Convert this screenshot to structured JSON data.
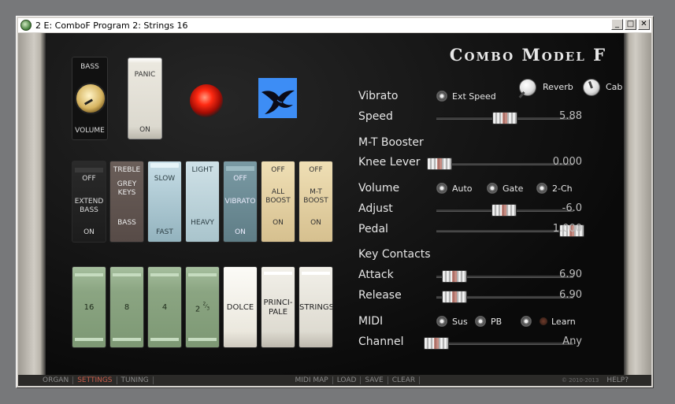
{
  "window": {
    "title": "2 E: ComboF Program 2: Strings 16",
    "buttons": [
      "_",
      "□",
      "✕"
    ]
  },
  "logo": "Combo Model F",
  "volume_box": {
    "top": "BASS",
    "bottom": "VOLUME"
  },
  "panic": {
    "top": "PANIC",
    "bottom": "ON"
  },
  "switches": [
    {
      "t": "OFF",
      "m": "EXTEND\nBASS",
      "b": "ON"
    },
    {
      "t": "TREBLE",
      "m": "GREY\nKEYS",
      "b": "BASS"
    },
    {
      "t": "SLOW",
      "m": "",
      "b": "FAST"
    },
    {
      "t": "LIGHT",
      "m": "",
      "b": "HEAVY"
    },
    {
      "t": "OFF",
      "m": "VIBRATO",
      "b": "ON"
    },
    {
      "t": "OFF",
      "m": "ALL\nBOOST",
      "b": "ON"
    },
    {
      "t": "OFF",
      "m": "M-T\nBOOST",
      "b": "ON"
    }
  ],
  "footages": [
    "16",
    "8",
    "4",
    "2",
    "DOLCE",
    "PRINCI-\nPALE",
    "STRINGS"
  ],
  "footage_fraction": {
    "num": "2",
    "den": "3"
  },
  "controls": {
    "vibrato_label": "Vibrato",
    "ext_speed": "Ext Speed",
    "reverb": "Reverb",
    "cab": "Cab",
    "speed_label": "Speed",
    "speed_value": "5.88",
    "mt_booster": "M-T Booster",
    "knee_label": "Knee Lever",
    "knee_value": "0.000",
    "volume_label": "Volume",
    "auto": "Auto",
    "gate": "Gate",
    "twoch": "2-Ch",
    "adjust_label": "Adjust",
    "adjust_value": "-6.0",
    "pedal_label": "Pedal",
    "pedal_value": "1.000",
    "key_contacts": "Key Contacts",
    "attack_label": "Attack",
    "attack_value": "6.90",
    "release_label": "Release",
    "release_value": "6.90",
    "midi_label": "MIDI",
    "sus": "Sus",
    "pb": "PB",
    "learn": "Learn",
    "channel_label": "Channel",
    "channel_value": "Any"
  },
  "bottom": {
    "organ": "ORGAN",
    "settings": "SETTINGS",
    "tuning": "TUNING",
    "midi_map": "MIDI MAP",
    "load": "LOAD",
    "save": "SAVE",
    "clear": "CLEAR",
    "copyright": "© 2010-2013",
    "help": "HELP?"
  },
  "colors": {
    "accent": "#c75c4a",
    "led": "#ff2a12",
    "bird_bg": "#3d8df5"
  }
}
